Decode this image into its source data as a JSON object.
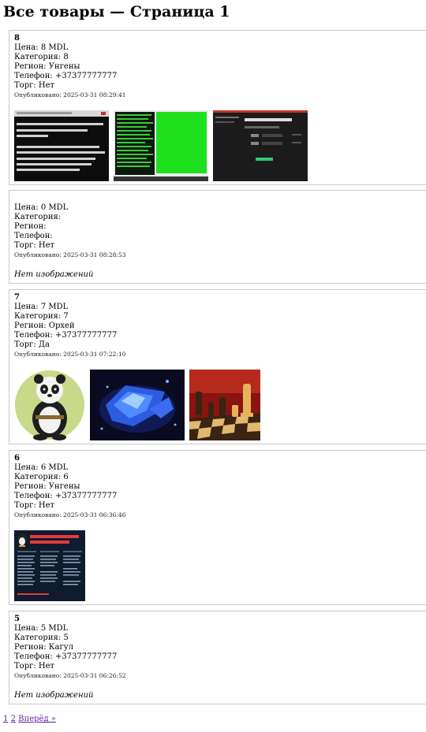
{
  "page_title": "Все товары — Страница 1",
  "labels": {
    "price": "Цена:",
    "category": "Категория:",
    "region": "Регион:",
    "phone": "Телефон:",
    "bargain": "Торг:",
    "published": "Опубликовано:",
    "no_images": "Нет изображений"
  },
  "items": [
    {
      "title": "8",
      "price": "8 MDL",
      "category": "8",
      "region": "Унгены",
      "phone": "+37377777777",
      "bargain": "Нет",
      "published": "2025-03-31 08:29:41",
      "images": [
        "terminal-screenshot",
        "green-terminal-screenshot",
        "dark-settings-screenshot"
      ]
    },
    {
      "title": "",
      "price": "0 MDL",
      "category": "",
      "region": "",
      "phone": "",
      "bargain": "Нет",
      "published": "2025-03-31 08:28:53",
      "images": []
    },
    {
      "title": "7",
      "price": "7 MDL",
      "category": "7",
      "region": "Орхей",
      "phone": "+37377777777",
      "bargain": "Да",
      "published": "2025-03-31 07:22:10",
      "images": [
        "panda-image",
        "blue-crystal-image",
        "chess-pieces-image"
      ]
    },
    {
      "title": "6",
      "price": "6 MDL",
      "category": "6",
      "region": "Унгены",
      "phone": "+37377777777",
      "bargain": "Нет",
      "published": "2025-03-31 06:36:46",
      "images": [
        "linux-cheatsheet-image"
      ]
    },
    {
      "title": "5",
      "price": "5 MDL",
      "category": "5",
      "region": "Кагул",
      "phone": "+37377777777",
      "bargain": "Нет",
      "published": "2025-03-31 06:26:52",
      "images": []
    }
  ],
  "pagination": {
    "page1": "1",
    "page2": "2",
    "next": "Вперёд »"
  }
}
